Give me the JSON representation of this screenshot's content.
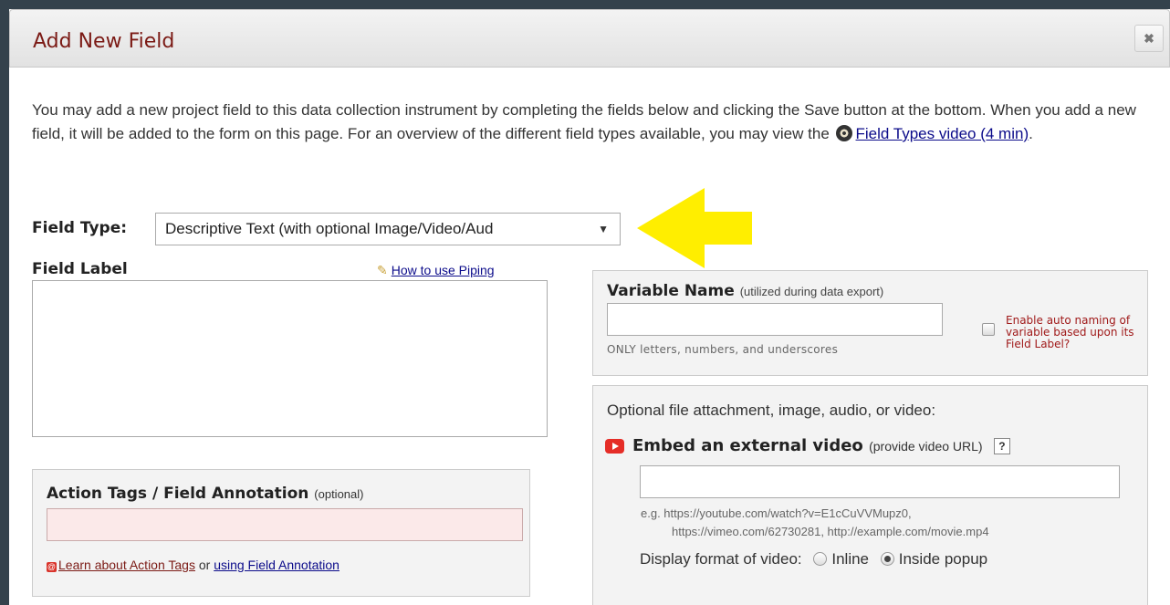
{
  "dialog": {
    "title": "Add New Field",
    "close_label": "✖"
  },
  "intro": {
    "text": "You may add a new project field to this data collection instrument by completing the fields below and clicking the Save button at the bottom. When you add a new field, it will be added to the form on this page. For an overview of the different field types available, you may view the",
    "video_link": "Field Types video (4 min)",
    "trailing": "."
  },
  "field_type": {
    "label": "Field Type:",
    "selected": "Descriptive Text (with optional Image/Video/Aud"
  },
  "field_label": {
    "label": "Field Label",
    "piping_link": "How to use Piping",
    "value": ""
  },
  "action_tags": {
    "title": "Action Tags / Field Annotation",
    "optional": "(optional)",
    "value": "",
    "learn_link": "Learn about Action Tags",
    "or": "or",
    "annotation_link": "using Field Annotation"
  },
  "variable_name": {
    "title": "Variable Name",
    "subtitle": "(utilized during data export)",
    "value": "",
    "hint": "ONLY letters, numbers, and underscores",
    "auto_naming": "Enable auto naming of variable based upon its Field Label?",
    "auto_naming_checked": false
  },
  "attachment": {
    "title": "Optional file attachment, image, audio, or video:",
    "embed_title": "Embed an external video",
    "embed_sub": "(provide video URL)",
    "help": "?",
    "video_url": "",
    "example_line1": "e.g. https://youtube.com/watch?v=E1cCuVVMupz0,",
    "example_line2": "https://vimeo.com/62730281, http://example.com/movie.mp4",
    "display_label": "Display format of video:",
    "option_inline": "Inline",
    "option_popup": "Inside popup",
    "selected_option": "Inside popup"
  },
  "colors": {
    "title": "#7b1a15",
    "link": "#0b0b8a",
    "highlight_arrow": "#ffee00",
    "youtube": "#e52d27"
  },
  "icons": {
    "film": "film-reel-icon",
    "pencil": "pencil-icon",
    "youtube": "youtube-icon",
    "action_tag": "action-tag-icon"
  }
}
